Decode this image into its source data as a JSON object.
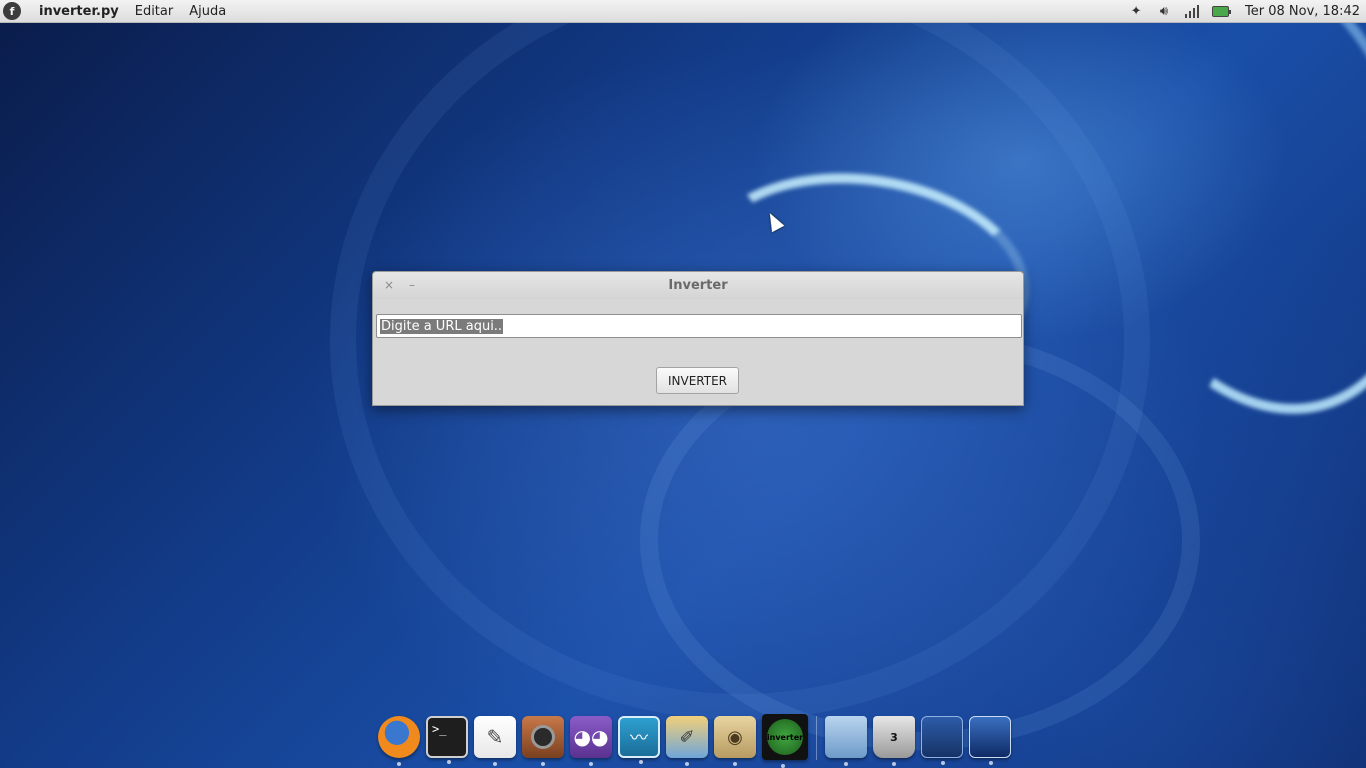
{
  "top_panel": {
    "app_title": "inverter.py",
    "menus": [
      "Editar",
      "Ajuda"
    ],
    "clock": "Ter 08 Nov, 18:42"
  },
  "window": {
    "title": "Inverter",
    "close_glyph": "×",
    "minimize_glyph": "–",
    "url_input_value": "Digite a URL aqui..",
    "button_label": "INVERTER"
  },
  "dock": {
    "trash_count": "3",
    "inverter_app_label": "inverter"
  },
  "icons": {
    "tray": [
      "dropbox-icon",
      "volume-icon",
      "network-signal-icon",
      "battery-icon"
    ],
    "dock": [
      "firefox-icon",
      "terminal-icon",
      "text-editor-icon",
      "audio-player-icon",
      "bird-client-icon",
      "system-monitor-icon",
      "design-tool-icon",
      "gimp-icon",
      "inverter-app-icon",
      "folder-icon",
      "trash-icon",
      "workspaces-icon",
      "desktop-screens-icon"
    ]
  },
  "colors": {
    "panel_bg": "#e6e6e6",
    "window_bg": "#d7d7d7",
    "selection": "#7b7b7b"
  }
}
